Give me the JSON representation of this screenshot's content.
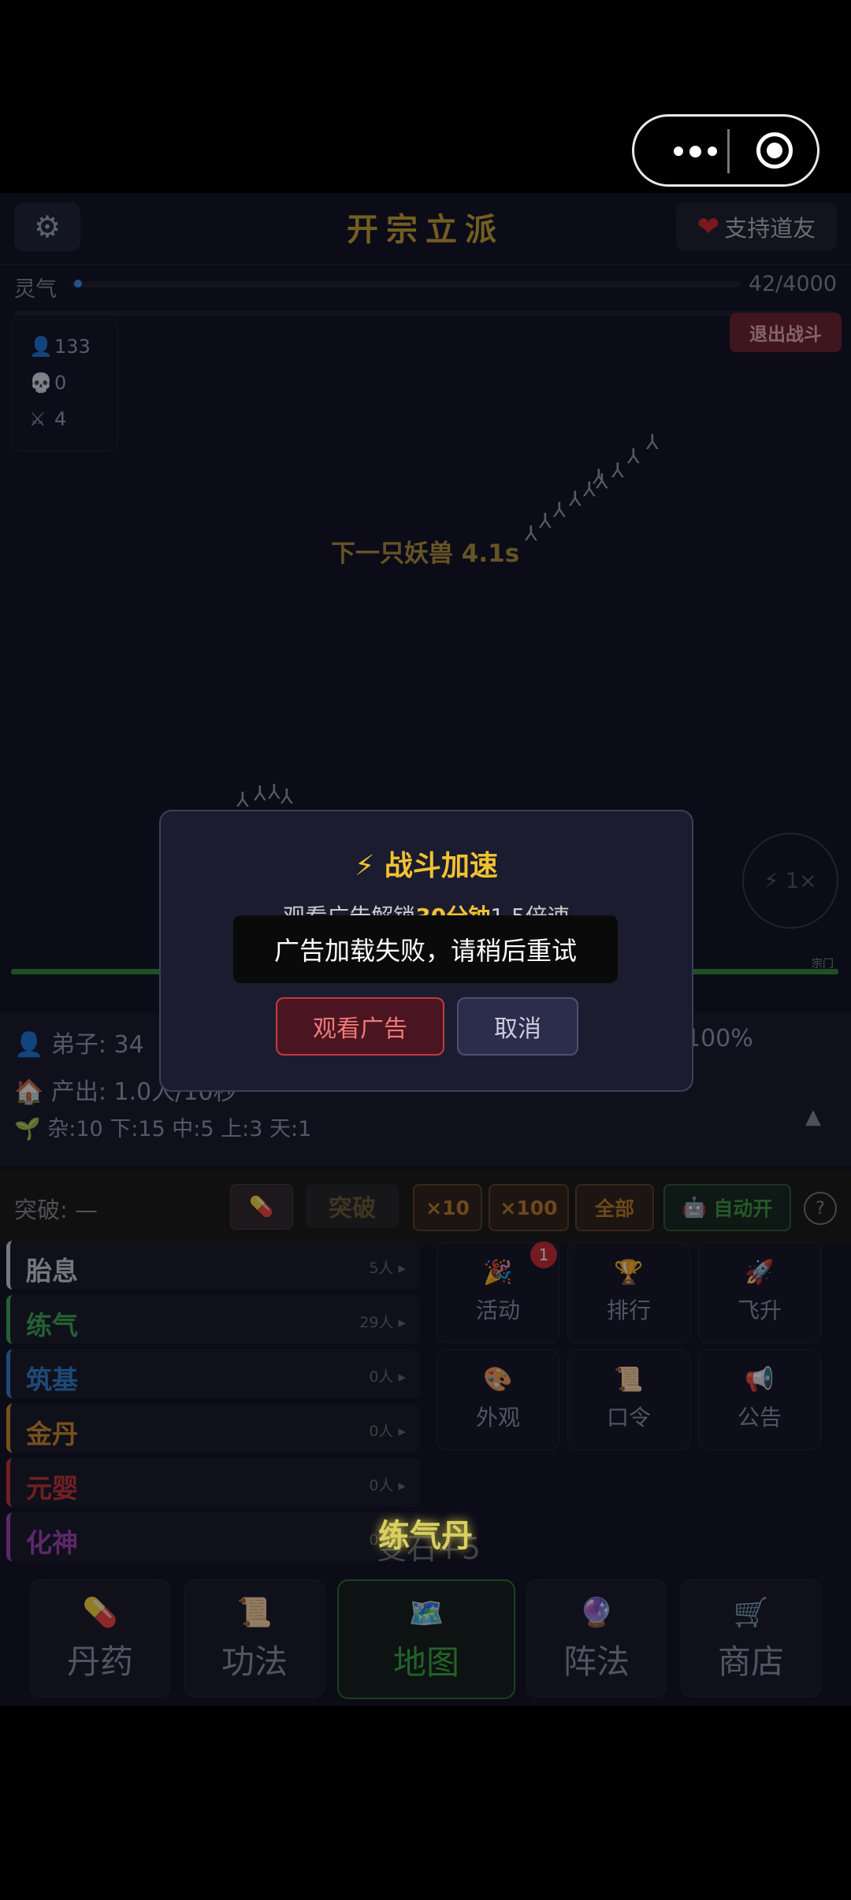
{
  "header": {
    "title": "开宗立派",
    "support_label": "支持道友"
  },
  "qi": {
    "label": "灵气",
    "value": "42/4000",
    "fraction": 0.0105
  },
  "exit_battle": "退出战斗",
  "stats": {
    "disciples": "133",
    "deaths": "0",
    "kills": "4"
  },
  "battle": {
    "next_monster": "下一只妖兽 4.1s",
    "speed": "1×",
    "gate": "宗门"
  },
  "info": {
    "disciples": "弟子: 34",
    "rate": "100%",
    "output": "产出: 1.0人/10秒",
    "grades": "杂:10 下:15 中:5 上:3 天:1"
  },
  "breakthrough": {
    "label": "突破: —",
    "pill_icon": "pill-icon",
    "button": "突破",
    "x10": "×10",
    "x100": "×100",
    "all": "全部",
    "auto": "自动开",
    "help": "?"
  },
  "realms": [
    {
      "name": "胎息",
      "count": "5人 ▸",
      "color": "#cfcfcf"
    },
    {
      "name": "练气",
      "count": "29人 ▸",
      "color": "#3aa84a"
    },
    {
      "name": "筑基",
      "count": "0人 ▸",
      "color": "#2f7fc8"
    },
    {
      "name": "金丹",
      "count": "0人 ▸",
      "color": "#d08a20"
    },
    {
      "name": "元婴",
      "count": "0人 ▸",
      "color": "#c83030"
    },
    {
      "name": "化神",
      "count": "0人 ▸",
      "color": "#a040b0"
    }
  ],
  "features": [
    {
      "label": "活动",
      "icon": "🎉"
    },
    {
      "label": "排行",
      "icon": "🏆"
    },
    {
      "label": "飞升",
      "icon": "🚀"
    },
    {
      "label": "外观",
      "icon": "🎨"
    },
    {
      "label": "口令",
      "icon": "📜"
    },
    {
      "label": "公告",
      "icon": "📢"
    }
  ],
  "activity_badge": "1",
  "floating_text": "练气丹",
  "floating_text_behind": "变石+5",
  "nav": [
    {
      "label": "丹药",
      "icon": "💊"
    },
    {
      "label": "功法",
      "icon": "📜"
    },
    {
      "label": "地图",
      "icon": "🗺️"
    },
    {
      "label": "阵法",
      "icon": "🔮"
    },
    {
      "label": "商店",
      "icon": "🛒"
    }
  ],
  "modal": {
    "title": "⚡ 战斗加速",
    "desc_prefix": "观看广告解锁",
    "desc_highlight": "30分钟",
    "desc_suffix": "1.5倍速",
    "watch": "观看广告",
    "cancel": "取消"
  },
  "toast": "广告加载失败，请稍后重试"
}
